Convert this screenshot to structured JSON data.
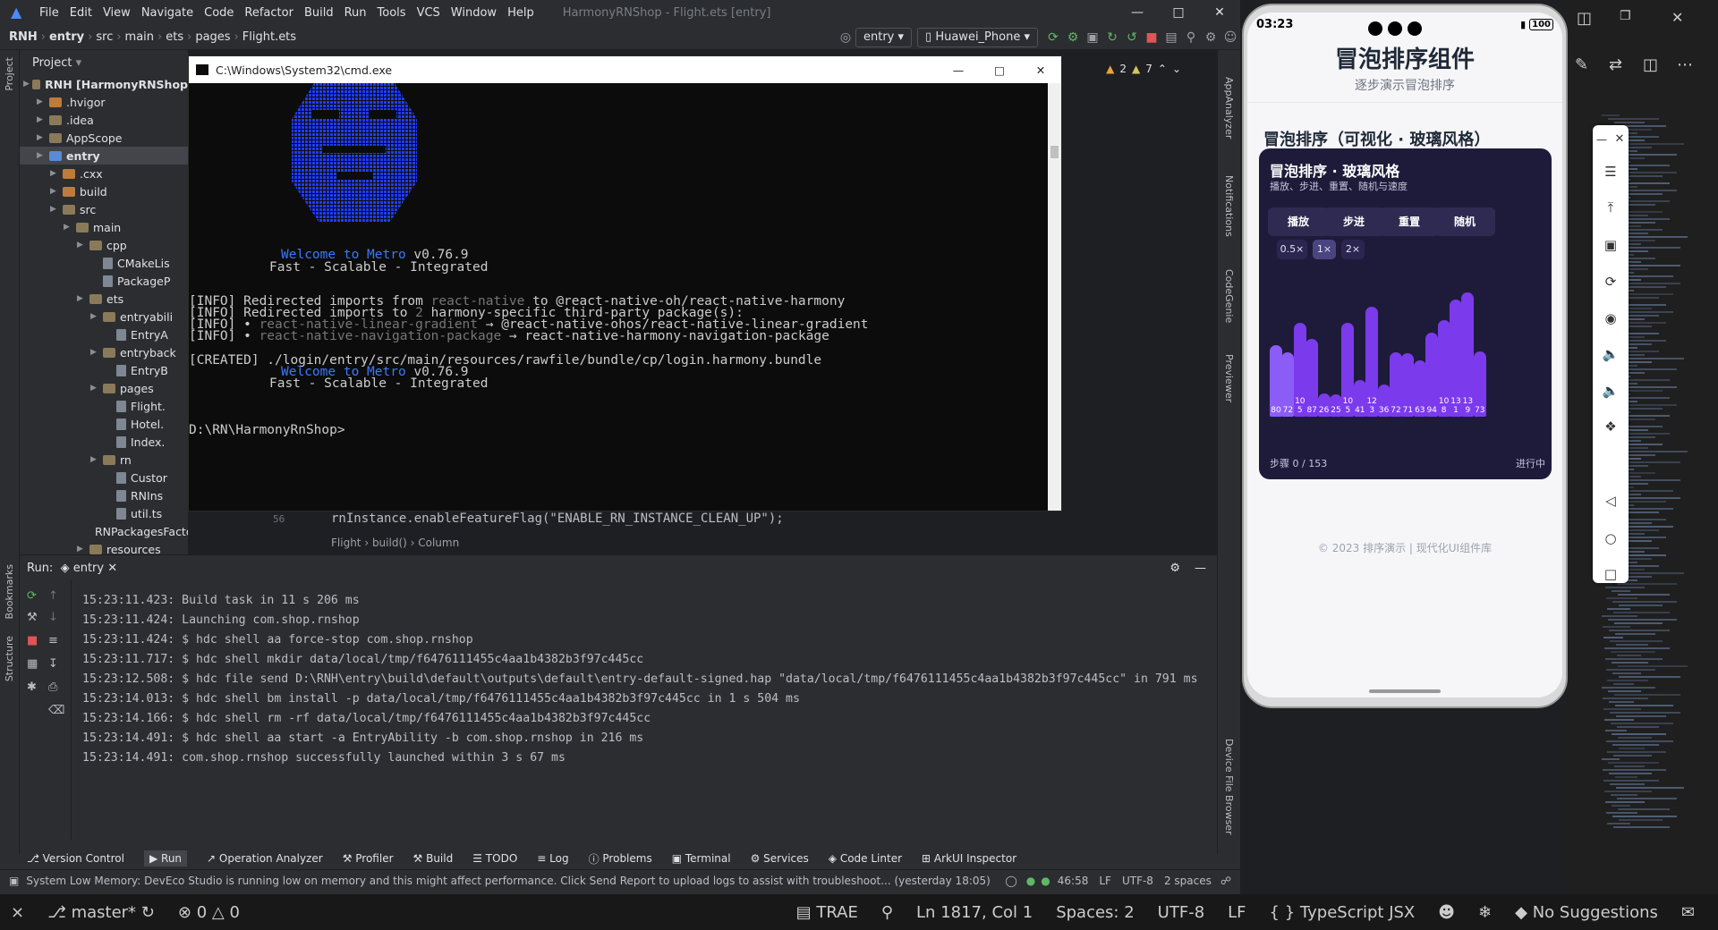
{
  "ide": {
    "menu": [
      "File",
      "Edit",
      "View",
      "Navigate",
      "Code",
      "Refactor",
      "Build",
      "Run",
      "Tools",
      "VCS",
      "Window",
      "Help"
    ],
    "title": "HarmonyRNShop - Flight.ets [entry]",
    "breadcrumb": [
      "RNH",
      "entry",
      "src",
      "main",
      "ets",
      "pages",
      "Flight.ets"
    ],
    "run_config": "entry",
    "device": "Huawei_Phone",
    "left_strip": {
      "project": "Project",
      "bookmarks": "Bookmarks",
      "structure": "Structure"
    },
    "right_strip": {
      "app_analyzer": "AppAnalyzer",
      "notifications": "Notifications",
      "codegenie": "CodeGenie",
      "previewer": "Previewer",
      "device_file_browser": "Device File Browser"
    },
    "project_panel": {
      "title": "Project",
      "rows": [
        {
          "label": "RNH [HarmonyRNShop",
          "indent": 0,
          "type": "folder"
        },
        {
          "label": ".hvigor",
          "indent": 1,
          "type": "folder-orange"
        },
        {
          "label": ".idea",
          "indent": 1,
          "type": "folder"
        },
        {
          "label": "AppScope",
          "indent": 1,
          "type": "folder"
        },
        {
          "label": "entry",
          "indent": 1,
          "type": "folder-blue"
        },
        {
          "label": ".cxx",
          "indent": 2,
          "type": "folder-orange"
        },
        {
          "label": "build",
          "indent": 2,
          "type": "folder-orange"
        },
        {
          "label": "src",
          "indent": 2,
          "type": "folder"
        },
        {
          "label": "main",
          "indent": 3,
          "type": "folder"
        },
        {
          "label": "cpp",
          "indent": 4,
          "type": "folder"
        },
        {
          "label": "CMakeLis",
          "indent": 5,
          "type": "file"
        },
        {
          "label": "PackageP",
          "indent": 5,
          "type": "file"
        },
        {
          "label": "ets",
          "indent": 4,
          "type": "folder"
        },
        {
          "label": "entryabili",
          "indent": 5,
          "type": "folder"
        },
        {
          "label": "EntryA",
          "indent": 6,
          "type": "file"
        },
        {
          "label": "entryback",
          "indent": 5,
          "type": "folder"
        },
        {
          "label": "EntryB",
          "indent": 6,
          "type": "file"
        },
        {
          "label": "pages",
          "indent": 5,
          "type": "folder"
        },
        {
          "label": "Flight.",
          "indent": 6,
          "type": "file"
        },
        {
          "label": "Hotel.",
          "indent": 6,
          "type": "file"
        },
        {
          "label": "Index.",
          "indent": 6,
          "type": "file"
        },
        {
          "label": "rn",
          "indent": 5,
          "type": "folder"
        },
        {
          "label": "Custor",
          "indent": 6,
          "type": "file"
        },
        {
          "label": "RNIns",
          "indent": 6,
          "type": "file"
        },
        {
          "label": "util.ts",
          "indent": 6,
          "type": "file"
        },
        {
          "label": "RNPackagesFactory.ets",
          "indent": 5,
          "type": "file"
        },
        {
          "label": "resources",
          "indent": 4,
          "type": "folder"
        }
      ]
    },
    "warnings": "2",
    "weak_warnings": "7",
    "code_line_no": "56",
    "code_line": "rnInstance.enableFeatureFlag(\"ENABLE_RN_INSTANCE_CLEAN_UP\");",
    "editor_crumbs": [
      "Flight",
      "build()",
      "Column"
    ],
    "run_panel": {
      "label": "Run:",
      "config": "entry",
      "lines": [
        "15:23:11.423: Build task in 11 s 206 ms",
        "15:23:11.424: Launching com.shop.rnshop",
        "15:23:11.424: $ hdc shell aa force-stop com.shop.rnshop",
        "15:23:11.717: $ hdc shell mkdir data/local/tmp/f6476111455c4aa1b4382b3f97c445cc",
        "15:23:12.508: $ hdc file send D:\\RNH\\entry\\build\\default\\outputs\\default\\entry-default-signed.hap \"data/local/tmp/f6476111455c4aa1b4382b3f97c445cc\" in 791 ms",
        "15:23:14.013: $ hdc shell bm install -p data/local/tmp/f6476111455c4aa1b4382b3f97c445cc  in 1 s 504 ms",
        "15:23:14.166: $ hdc shell rm -rf data/local/tmp/f6476111455c4aa1b4382b3f97c445cc",
        "15:23:14.491: $ hdc shell aa start -a EntryAbility -b com.shop.rnshop in 216 ms",
        "15:23:14.491: com.shop.rnshop successfully launched within 3 s 67 ms"
      ]
    },
    "tool_windows": [
      "Version Control",
      "Run",
      "Operation Analyzer",
      "Profiler",
      "Build",
      "TODO",
      "Log",
      "Problems",
      "Terminal",
      "Services",
      "Code Linter",
      "ArkUI Inspector"
    ],
    "status": {
      "message": "System Low Memory: DevEco Studio is running low on memory and this might affect performance. Click Send Report to upload logs to assist with troubleshoot... (yesterday 18:05)",
      "position": "46:58",
      "line_sep": "LF",
      "encoding": "UTF-8",
      "indent": "2 spaces"
    }
  },
  "cmd": {
    "title": "C:\\Windows\\System32\\cmd.exe",
    "welcome1": "Welcome to Metro",
    "version": "v0.76.9",
    "tagline": "Fast - Scalable - Integrated",
    "info_lines": [
      {
        "prefix": "[INFO] Redirected imports from ",
        "grey": "react-native",
        "mid": " to ",
        "rest": "@react-native-oh/react-native-harmony"
      },
      {
        "prefix": "[INFO] Redirected imports to ",
        "grey": "2",
        "mid": " harmony-specific third-party package(s):",
        "rest": ""
      },
      {
        "prefix": "[INFO] • ",
        "grey": "react-native-linear-gradient",
        "mid": " → ",
        "rest": "@react-native-ohos/react-native-linear-gradient"
      },
      {
        "prefix": "[INFO] • ",
        "grey": "react-native-navigation-package",
        "mid": " → ",
        "rest": "react-native-harmony-navigation-package"
      }
    ],
    "created": "[CREATED] ./login/entry/src/main/resources/rawfile/bundle/cp/login.harmony.bundle",
    "prompt": "D:\\RN\\HarmonyRnShop>"
  },
  "phone": {
    "time": "03:23",
    "battery": "100",
    "app_title": "冒泡排序组件",
    "app_subtitle": "逐步演示冒泡排序",
    "section_title": "冒泡排序（可视化 · 玻璃风格）",
    "card_title": "冒泡排序 · 玻璃风格",
    "card_subtitle": "播放、步进、重置、随机与速度",
    "buttons": [
      "播放",
      "步进",
      "重置",
      "随机"
    ],
    "speeds": [
      "0.5×",
      "1×",
      "2×"
    ],
    "selected_speed": "1×",
    "bar_values": [
      80,
      72,
      105,
      87,
      26,
      25,
      105,
      41,
      123,
      36,
      72,
      71,
      63,
      94,
      108,
      131,
      139,
      73
    ],
    "step_text": "步骤 0 / 153",
    "state_text": "进行中",
    "footer": "© 2023 排序演示 | 现代化UI组件库"
  },
  "vscode": {
    "branch": "master*",
    "errors": "0",
    "warnings": "0",
    "trae": "TRAE",
    "position": "Ln 1817, Col 1",
    "spaces": "Spaces: 2",
    "encoding": "UTF-8",
    "eol": "LF",
    "language": "TypeScript JSX",
    "suggestions": "No Suggestions"
  }
}
